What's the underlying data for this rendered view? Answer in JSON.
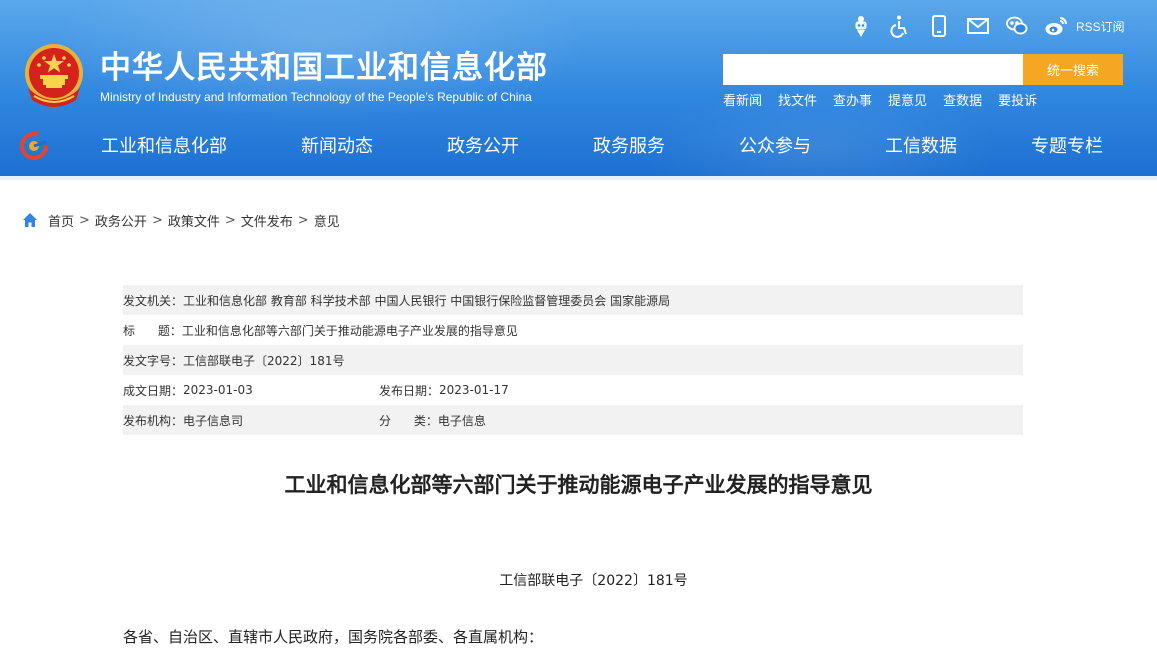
{
  "header": {
    "title_cn": "中华人民共和国工业和信息化部",
    "title_en": "Ministry of Industry and Information Technology of the People’s Republic of China",
    "top_icons": [
      "robot-icon",
      "accessibility-icon",
      "mobile-icon",
      "mail-icon",
      "wechat-icon",
      "weibo-icon"
    ],
    "rss_label": "RSS订阅",
    "search": {
      "placeholder": "",
      "button_label": "统一搜索"
    },
    "quick_links": [
      "看新闻",
      "找文件",
      "查办事",
      "提意见",
      "查数据",
      "要投诉"
    ],
    "nav": [
      "工业和信息化部",
      "新闻动态",
      "政务公开",
      "政务服务",
      "公众参与",
      "工信数据",
      "专题专栏"
    ],
    "colors": {
      "header_top": "#5aa7ea",
      "header_bottom": "#1c6fd0",
      "search_button": "#f5a623"
    }
  },
  "breadcrumb": [
    "首页",
    "政务公开",
    "政策文件",
    "文件发布",
    "意见"
  ],
  "meta": {
    "issuer_label": "发文机关：",
    "issuer_value": "工业和信息化部 教育部 科学技术部 中国人民银行 中国银行保险监督管理委员会 国家能源局",
    "title_label": "标      题：",
    "title_value": "工业和信息化部等六部门关于推动能源电子产业发展的指导意见",
    "docno_label": "发文字号：",
    "docno_value": "工信部联电子〔2022〕181号",
    "written_label": "成文日期：",
    "written_value": "2023-01-03",
    "published_label": "发布日期：",
    "published_value": "2023-01-17",
    "org_label": "发布机构：",
    "org_value": "电子信息司",
    "category_label": "分      类：",
    "category_value": "电子信息"
  },
  "article": {
    "title": "工业和信息化部等六部门关于推动能源电子产业发展的指导意见",
    "doc_number": "工信部联电子〔2022〕181号",
    "addressee": "各省、自治区、直辖市人民政府，国务院各部委、各直属机构："
  }
}
